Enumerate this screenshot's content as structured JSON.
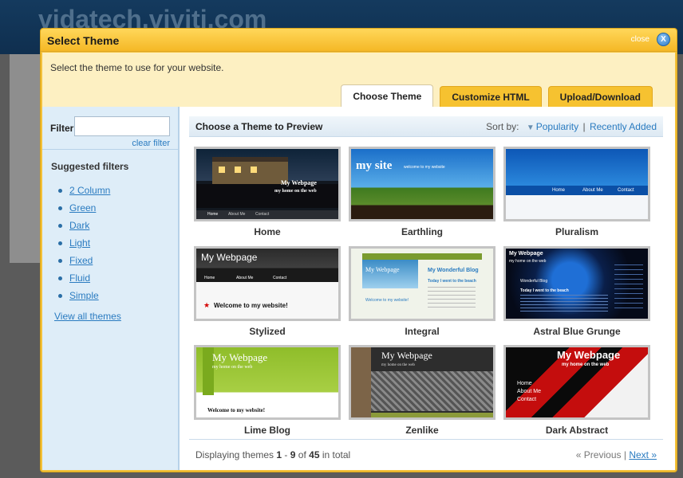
{
  "background": {
    "site_title": "vidatech.viviti.com"
  },
  "dialog": {
    "title": "Select Theme",
    "close_label": "close",
    "close_icon_glyph": "X",
    "intro": "Select the theme to use for your website.",
    "tabs": [
      {
        "label": "Choose Theme",
        "active": true
      },
      {
        "label": "Customize HTML",
        "active": false
      },
      {
        "label": "Upload/Download",
        "active": false
      }
    ]
  },
  "sidebar": {
    "filter_label": "Filter",
    "filter_value": "",
    "clear_filter": "clear filter",
    "suggested_title": "Suggested filters",
    "filters": [
      "2 Column",
      "Green",
      "Dark",
      "Light",
      "Fixed",
      "Fluid",
      "Simple"
    ],
    "view_all": "View all themes"
  },
  "main": {
    "title": "Choose a Theme to Preview",
    "sort_label": "Sort by:",
    "sort_popularity": "Popularity",
    "sort_separator": "|",
    "sort_recent": "Recently Added",
    "themes": [
      {
        "name": "Home",
        "thumb_title": "My Webpage",
        "thumb_subtitle": "my home on the web",
        "nav": [
          "Home",
          "About Me",
          "Contact"
        ]
      },
      {
        "name": "Earthling",
        "thumb_title": "my site",
        "thumb_subtitle": "welcome to my website"
      },
      {
        "name": "Pluralism",
        "nav": [
          "Home",
          "About Me",
          "Contact"
        ]
      },
      {
        "name": "Stylized",
        "thumb_title": "My Webpage",
        "nav": [
          "Home",
          "About Me",
          "Contact"
        ],
        "thumb_body": "Welcome to my website!"
      },
      {
        "name": "Integral",
        "thumb_title": "My Webpage",
        "thumb_heading": "My Wonderful Blog",
        "thumb_post": "Today I went to the beach",
        "thumb_body": "Welcome to my website!"
      },
      {
        "name": "Astral Blue Grunge",
        "thumb_title": "My Webpage",
        "thumb_subtitle": "my home on the web",
        "thumb_heading": "Wonderful Blog",
        "thumb_post": "Today I went to the beach"
      },
      {
        "name": "Lime Blog",
        "thumb_title": "My Webpage",
        "thumb_subtitle": "my home on the web",
        "thumb_body": "Welcome to my website!"
      },
      {
        "name": "Zenlike",
        "thumb_title": "My Webpage",
        "thumb_subtitle": "my home on the web"
      },
      {
        "name": "Dark Abstract",
        "thumb_title": "My Webpage",
        "thumb_subtitle": "my home on the web",
        "nav": [
          "Home",
          "About Me",
          "Contact"
        ]
      }
    ],
    "footer": {
      "prefix": "Displaying themes",
      "from": "1",
      "dash": " - ",
      "to": "9",
      "of": "of",
      "total": "45",
      "suffix": "in total",
      "previous": "« Previous",
      "separator": "|",
      "next": "Next »"
    }
  },
  "colors": {
    "dialog_yellow": "#f5b826",
    "link_blue": "#2a7bc0",
    "sidebar_blue": "#deedf8"
  }
}
